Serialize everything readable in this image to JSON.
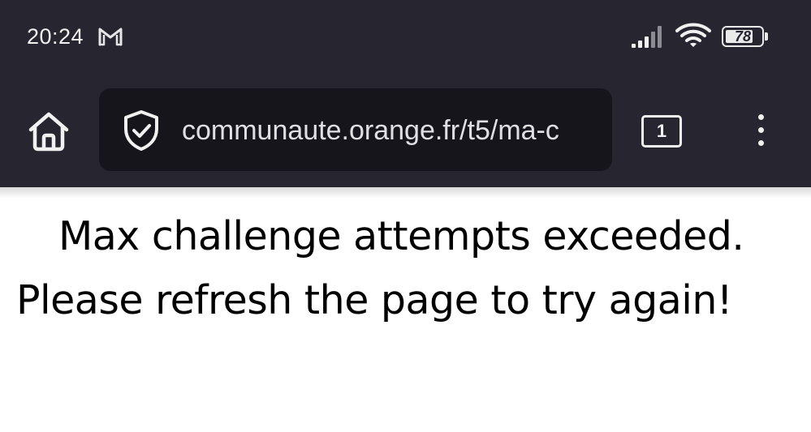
{
  "status_bar": {
    "time": "20:24",
    "notification_icon": "gmail-icon",
    "signal_icon": "signal-icon",
    "wifi_icon": "wifi-icon",
    "battery_level": "78",
    "battery_fraction": 0.78
  },
  "toolbar": {
    "home_icon": "home-icon",
    "security_icon": "shield-check-icon",
    "url": "communaute.orange.fr/t5/ma-c",
    "tab_count": "1",
    "menu_icon": "more-vert-icon"
  },
  "page": {
    "message": "Max challenge attempts exceeded. Please refresh the page to try again!"
  },
  "colors": {
    "chrome_background": "#27252f",
    "url_bar_background": "#16151c",
    "icon_color": "#f1f1f1",
    "page_background": "#ffffff",
    "text_color": "#000000"
  }
}
